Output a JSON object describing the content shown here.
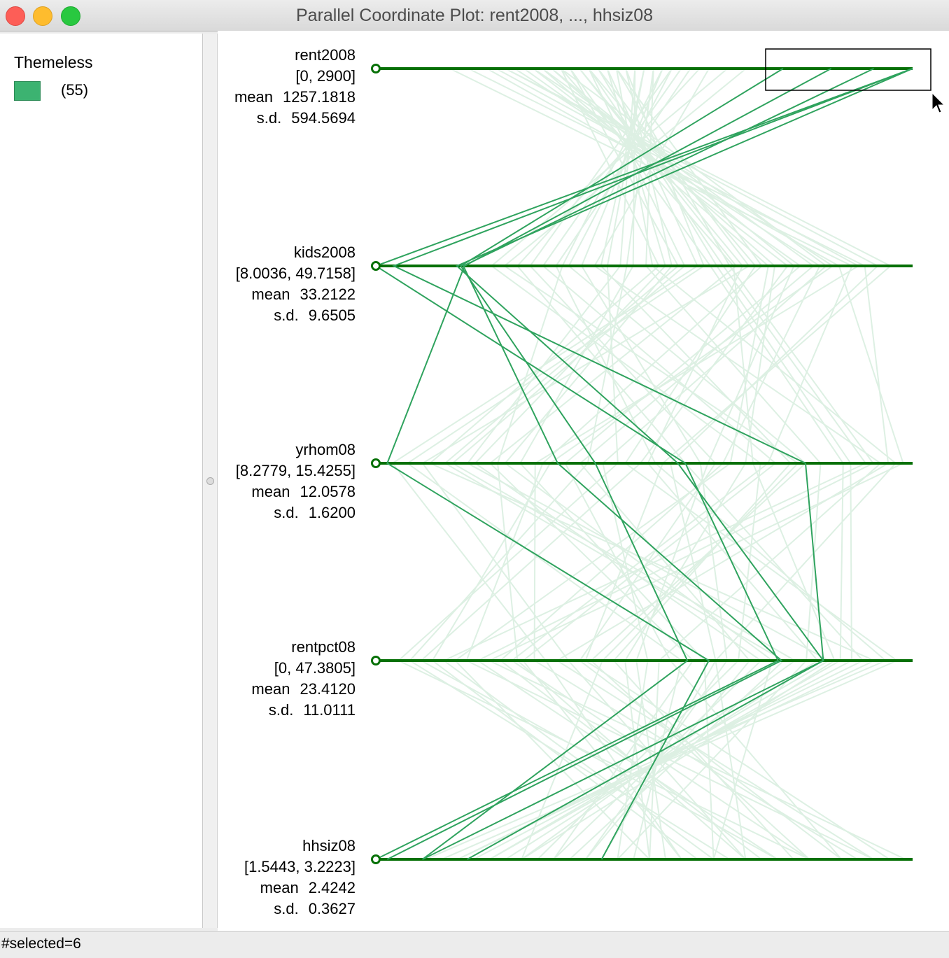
{
  "window": {
    "title": "Parallel Coordinate Plot: rent2008, ..., hhsiz08"
  },
  "legend": {
    "title": "Themeless",
    "count": "(55)",
    "swatch_color": "#3cb371"
  },
  "status": {
    "text": "#selected=6"
  },
  "colors": {
    "axis": "#067006",
    "selected_line": "#2fa35e",
    "unselected_line": "#ddf0e3"
  },
  "axes": [
    {
      "name": "rent2008",
      "range": "[0, 2900]",
      "mean_label": "mean",
      "mean": "1257.1818",
      "sd_label": "s.d.",
      "sd": "594.5694"
    },
    {
      "name": "kids2008",
      "range": "[8.0036, 49.7158]",
      "mean_label": "mean",
      "mean": "33.2122",
      "sd_label": "s.d.",
      "sd": "9.6505"
    },
    {
      "name": "yrhom08",
      "range": "[8.2779, 15.4255]",
      "mean_label": "mean",
      "mean": "12.0578",
      "sd_label": "s.d.",
      "sd": "1.6200"
    },
    {
      "name": "rentpct08",
      "range": "[0, 47.3805]",
      "mean_label": "mean",
      "mean": "23.4120",
      "sd_label": "s.d.",
      "sd": "11.0111"
    },
    {
      "name": "hhsiz08",
      "range": "[1.5443, 3.2223]",
      "mean_label": "mean",
      "mean": "2.4242",
      "sd_label": "s.d.",
      "sd": "0.3627"
    }
  ],
  "selected_lines": [
    [
      2900,
      8.0036,
      12.4,
      35.5,
      1.5443
    ],
    [
      2900,
      9.4,
      14.0,
      39.5,
      1.69
    ],
    [
      2900,
      14.3,
      12.3,
      39.5,
      1.83
    ],
    [
      2690,
      14.8,
      10.7,
      35.8,
      1.58
    ],
    [
      2460,
      14.9,
      8.43,
      29.4,
      2.25
    ],
    [
      2200,
      14.6,
      11.2,
      27.5,
      1.69
    ]
  ],
  "background_lines": [
    [
      1400,
      27.0,
      9.5,
      40.0,
      1.9
    ],
    [
      1150,
      35.0,
      14.8,
      6.0,
      2.6
    ],
    [
      900,
      42.0,
      11.0,
      33.0,
      2.2
    ],
    [
      1600,
      20.0,
      12.8,
      18.0,
      3.0
    ],
    [
      400,
      45.0,
      13.5,
      12.0,
      2.9
    ],
    [
      1000,
      30.0,
      9.0,
      44.0,
      1.8
    ],
    [
      1800,
      25.0,
      15.0,
      25.0,
      2.4
    ],
    [
      1300,
      38.0,
      10.5,
      8.0,
      3.1
    ],
    [
      700,
      47.0,
      12.2,
      30.0,
      2.7
    ],
    [
      2000,
      18.0,
      13.9,
      20.0,
      2.0
    ],
    [
      1250,
      33.0,
      8.5,
      15.0,
      2.5
    ],
    [
      1500,
      29.0,
      14.2,
      38.0,
      2.3
    ],
    [
      850,
      40.0,
      11.8,
      4.0,
      2.8
    ],
    [
      1100,
      36.0,
      9.8,
      28.0,
      2.1
    ],
    [
      1700,
      22.0,
      12.0,
      45.0,
      1.7
    ],
    [
      600,
      44.0,
      15.3,
      10.0,
      3.2
    ],
    [
      1350,
      31.0,
      10.0,
      35.0,
      2.6
    ],
    [
      950,
      39.0,
      13.2,
      22.0,
      2.4
    ],
    [
      1450,
      26.0,
      11.5,
      2.0,
      2.9
    ],
    [
      1050,
      34.0,
      14.5,
      41.0,
      1.9
    ],
    [
      1200,
      37.0,
      8.9,
      17.0,
      2.7
    ],
    [
      1550,
      24.0,
      12.6,
      31.0,
      2.2
    ],
    [
      800,
      41.0,
      10.8,
      26.0,
      3.0
    ],
    [
      1650,
      21.0,
      13.6,
      13.0,
      2.5
    ],
    [
      1150,
      32.0,
      9.3,
      37.0,
      2.0
    ],
    [
      1300,
      35.5,
      14.9,
      9.0,
      2.8
    ],
    [
      1000,
      43.0,
      11.3,
      24.0,
      2.3
    ],
    [
      1750,
      19.0,
      12.4,
      43.0,
      1.8
    ],
    [
      500,
      46.0,
      15.1,
      16.0,
      3.1
    ],
    [
      1400,
      28.0,
      10.2,
      29.0,
      2.6
    ],
    [
      900,
      38.5,
      13.0,
      7.0,
      2.4
    ],
    [
      1250,
      30.5,
      9.6,
      34.0,
      2.1
    ],
    [
      1600,
      23.0,
      14.0,
      19.0,
      2.9
    ],
    [
      1100,
      36.5,
      11.9,
      39.0,
      1.95
    ],
    [
      750,
      42.5,
      12.9,
      11.0,
      2.75
    ],
    [
      1350,
      33.5,
      8.7,
      27.0,
      2.35
    ],
    [
      1900,
      17.0,
      13.4,
      32.0,
      2.05
    ],
    [
      650,
      45.5,
      10.4,
      14.0,
      3.05
    ],
    [
      1200,
      34.5,
      14.6,
      42.0,
      1.85
    ],
    [
      1500,
      27.5,
      11.1,
      3.0,
      2.65
    ],
    [
      950,
      40.5,
      12.7,
      23.0,
      2.45
    ],
    [
      1050,
      31.5,
      9.2,
      36.0,
      2.15
    ],
    [
      1450,
      25.5,
      13.8,
      21.0,
      2.85
    ],
    [
      850,
      43.5,
      10.6,
      5.0,
      2.55
    ],
    [
      1300,
      29.5,
      15.2,
      30.0,
      2.25
    ],
    [
      1150,
      37.5,
      11.6,
      46.0,
      1.75
    ],
    [
      700,
      48.0,
      12.1,
      18.5,
      3.15
    ],
    [
      1550,
      22.5,
      9.9,
      12.5,
      2.7
    ],
    [
      1000,
      35.8,
      13.3,
      40.5,
      2.0
    ]
  ]
}
